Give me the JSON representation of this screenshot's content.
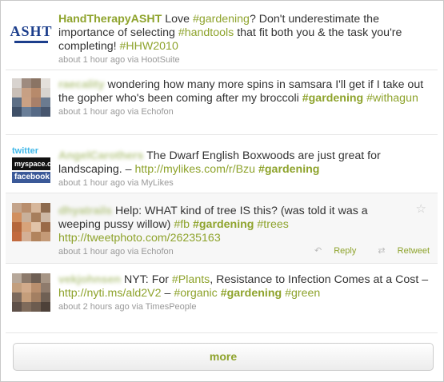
{
  "tweets": [
    {
      "user": "HandTherapyASHT",
      "text_parts": [
        {
          "t": " Love ",
          "k": "text"
        },
        {
          "t": "#gardening",
          "k": "tag"
        },
        {
          "t": "? Don't underestimate the importance of selecting ",
          "k": "text"
        },
        {
          "t": "#handtools",
          "k": "tag"
        },
        {
          "t": " that fit both you & the task you're completing! ",
          "k": "text"
        },
        {
          "t": "#HHW2010",
          "k": "tag"
        }
      ],
      "time": "about 1 hour ago",
      "via": "via HootSuite",
      "avatar": "ASHT"
    },
    {
      "user": "raecality",
      "text_parts": [
        {
          "t": " wondering how many more spins in samsara I'll get if I take out the gopher who's been coming after my broccoli ",
          "k": "text"
        },
        {
          "t": "#gardening",
          "k": "tag-bold"
        },
        {
          "t": " ",
          "k": "text"
        },
        {
          "t": "#withagun",
          "k": "tag"
        }
      ],
      "time": "about 1 hour ago",
      "via": "via Echofon"
    },
    {
      "user": "AngelCarothers",
      "text_parts": [
        {
          "t": " The Dwarf English Boxwoods are just great for landscaping. – ",
          "k": "text"
        },
        {
          "t": "http://mylikes.com/r/Bzu",
          "k": "link"
        },
        {
          "t": " ",
          "k": "text"
        },
        {
          "t": "#gardening",
          "k": "tag-bold"
        }
      ],
      "time": "about 1 hour ago",
      "via": "via MyLikes",
      "avatar_labels": {
        "twitter": "twitter",
        "myspace": "myspace.com",
        "facebook": "facebook"
      }
    },
    {
      "user": "dhyatrails",
      "text_parts": [
        {
          "t": " Help: WHAT kind of tree IS this? (was told it was a weeping pussy willow) ",
          "k": "text"
        },
        {
          "t": "#fb",
          "k": "tag"
        },
        {
          "t": " ",
          "k": "text"
        },
        {
          "t": "#gardening",
          "k": "tag-bold"
        },
        {
          "t": " ",
          "k": "text"
        },
        {
          "t": "#trees",
          "k": "tag"
        },
        {
          "t": " ",
          "k": "text"
        },
        {
          "t": "http://tweetphoto.com/26235163",
          "k": "link"
        }
      ],
      "time": "about 1 hour ago",
      "via": "via Echofon",
      "actions": {
        "reply": "Reply",
        "retweet": "Retweet"
      }
    },
    {
      "user": "vekjohnsen",
      "text_parts": [
        {
          "t": " NYT: For ",
          "k": "text"
        },
        {
          "t": "#Plants",
          "k": "tag"
        },
        {
          "t": ", Resistance to Infection Comes at a Cost – ",
          "k": "text"
        },
        {
          "t": "http://nyti.ms/ald2V2",
          "k": "link"
        },
        {
          "t": " – ",
          "k": "text"
        },
        {
          "t": "#organic",
          "k": "tag"
        },
        {
          "t": " ",
          "k": "text"
        },
        {
          "t": "#gardening",
          "k": "tag-bold"
        },
        {
          "t": " ",
          "k": "text"
        },
        {
          "t": "#green",
          "k": "tag"
        }
      ],
      "time": "about 2 hours ago",
      "via": "via TimesPeople"
    }
  ],
  "more_label": "more",
  "colors": {
    "accent": "#8ea32c",
    "meta": "#999999"
  }
}
